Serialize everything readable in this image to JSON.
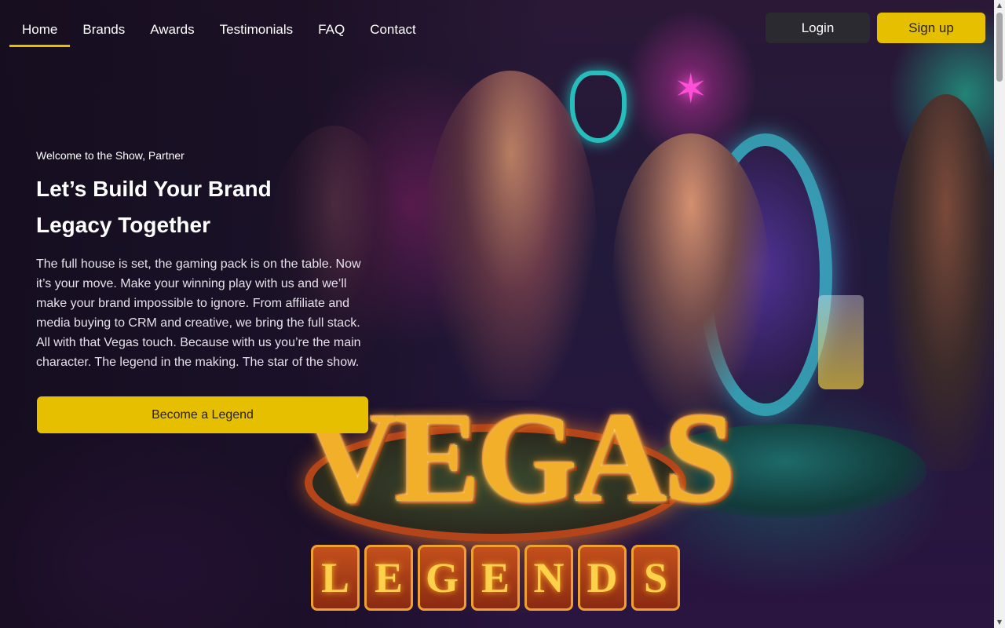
{
  "nav": {
    "items": [
      {
        "label": "Home",
        "active": true
      },
      {
        "label": "Brands"
      },
      {
        "label": "Awards"
      },
      {
        "label": "Testimonials"
      },
      {
        "label": "FAQ"
      },
      {
        "label": "Contact"
      }
    ]
  },
  "auth": {
    "login_label": "Login",
    "signup_label": "Sign up"
  },
  "hero": {
    "kicker": "Welcome to the Show, Partner",
    "headline_line1": "Let’s Build Your Brand",
    "headline_line2": "Legacy Together",
    "body": "The full house is set, the gaming pack is on the table. Now it’s your move. Make your winning play with us and we’ll make your brand impossible to ignore. From affiliate and media buying to CRM and creative, we bring the full stack. All with that Vegas touch. Because with us you’re the main character. The legend in the making. The star of the show.",
    "cta_label": "Become a Legend"
  },
  "logo": {
    "word1": "VEGAS",
    "word2_letters": [
      "L",
      "E",
      "G",
      "E",
      "N",
      "D",
      "S"
    ]
  },
  "colors": {
    "accent": "#e6c000",
    "login_bg": "#2b2a30",
    "background": "#1a0f24"
  },
  "scrollbar": {
    "up_icon": "chevron-up-icon",
    "down_icon": "chevron-down-icon"
  }
}
